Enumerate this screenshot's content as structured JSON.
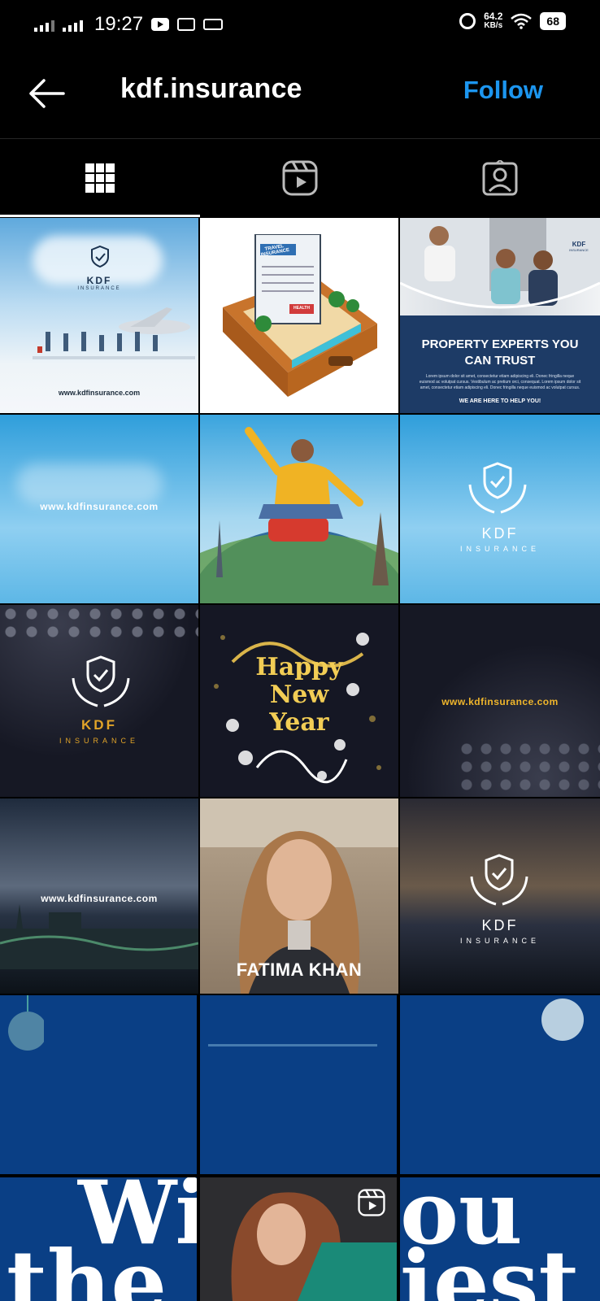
{
  "status_bar": {
    "time": "19:27",
    "net_speed_value": "64.2",
    "net_speed_unit": "KB/s",
    "battery": "68",
    "icons": [
      "signal-icon",
      "signal-icon",
      "youtube-icon",
      "news-icon",
      "laptop-icon",
      "alarm-icon",
      "wifi-icon",
      "battery-icon"
    ]
  },
  "header": {
    "username": "kdf.insurance",
    "follow_label": "Follow",
    "follow_color": "#1c96f0"
  },
  "tabs": [
    {
      "name": "posts",
      "icon": "grid-icon",
      "active": true
    },
    {
      "name": "reels",
      "icon": "reels-icon",
      "active": false
    },
    {
      "name": "tagged",
      "icon": "tagged-icon",
      "active": false
    }
  ],
  "posts": [
    {
      "url": "www.kdfinsurance.com",
      "logo_title": "KDF",
      "logo_sub": "INSURANCE"
    },
    {
      "badge_travel": "TRAVEL INSURANCE",
      "badge_health": "HEALTH"
    },
    {
      "headline": "PROPERTY EXPERTS YOU CAN TRUST",
      "body": "Lorem ipsum dolor sit amet, consectetur etiam adipiscing eli. Donec fringilla neque euismod ac volutpat cursus. Vestibulum ac pretium orci, consequat. Lorem ipsum dolor sit amet, consectetur etiam adipiscing eli. Donec fringilla neque euismod ac volutpat cursus.",
      "footer": "WE ARE HERE TO HELP YOU!",
      "logo_title": "KDF",
      "logo_sub": "INSURANCE"
    },
    {
      "url": "www.kdfinsurance.com"
    },
    {},
    {
      "logo_title": "KDF",
      "logo_sub": "INSURANCE"
    },
    {
      "logo_title": "KDF",
      "logo_sub": "INSURANCE"
    },
    {
      "line1": "Happy",
      "line2": "New",
      "line3": "Year"
    },
    {
      "url": "www.kdfinsurance.com"
    },
    {
      "url": "www.kdfinsurance.com"
    },
    {
      "caption": "FATIMA KHAN"
    },
    {
      "logo_title": "KDF",
      "logo_sub": "INSURANCE"
    }
  ],
  "bottom_text": {
    "line1": "Wi",
    "line1b": "ou",
    "line2": "the",
    "line2b": "iest"
  }
}
